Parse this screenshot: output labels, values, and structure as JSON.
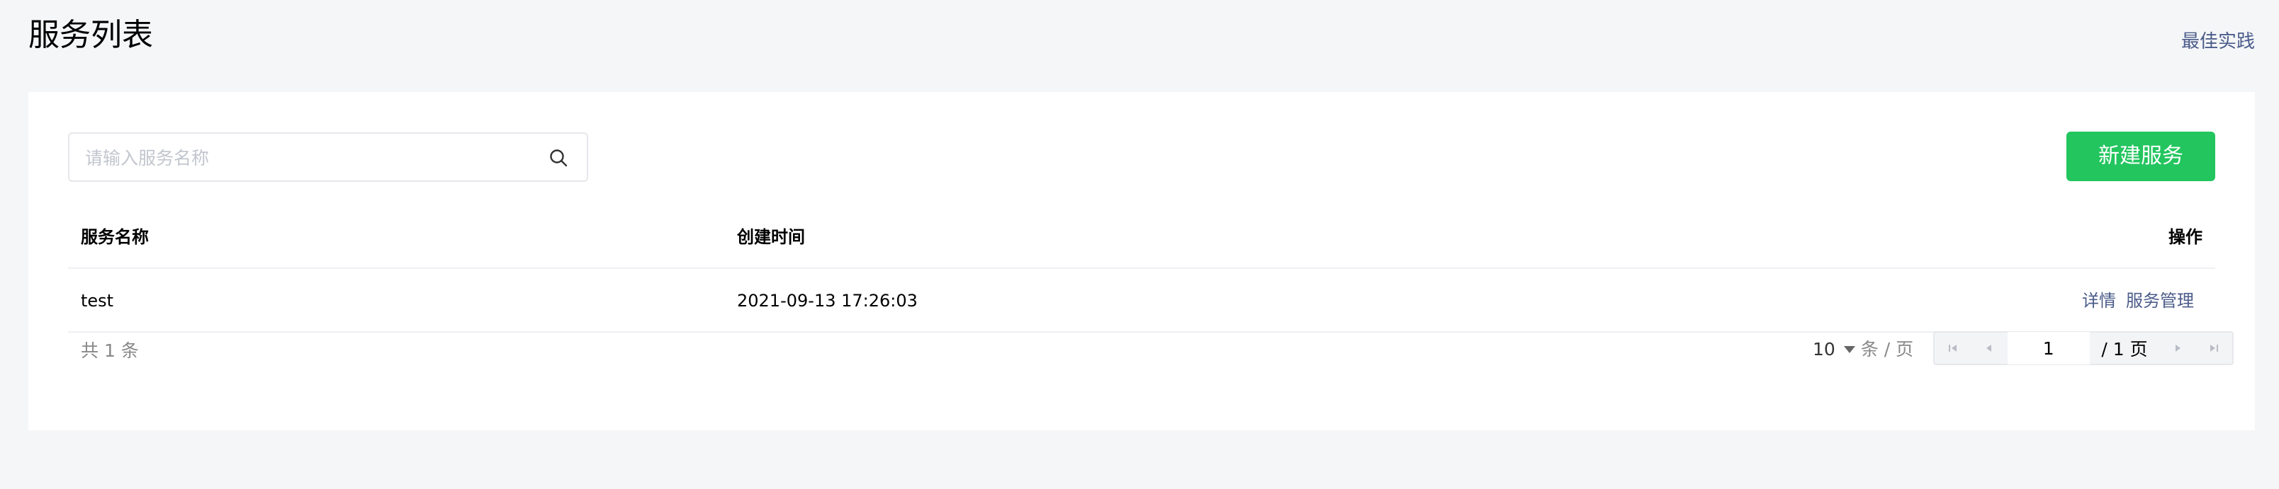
{
  "header": {
    "title": "服务列表",
    "best_practice": "最佳实践"
  },
  "search": {
    "placeholder": "请输入服务名称",
    "value": ""
  },
  "actions": {
    "new_service": "新建服务"
  },
  "table": {
    "columns": [
      "服务名称",
      "创建时间",
      "操作"
    ],
    "rows": [
      {
        "name": "test",
        "created": "2021-09-13 17:26:03",
        "ops": [
          "详情",
          "服务管理"
        ]
      }
    ]
  },
  "pagination": {
    "total_text": "共 1 条",
    "page_size": "10",
    "per_page_label": "条 / 页",
    "current_page": "1",
    "total_pages_text": "/ 1 页"
  },
  "colors": {
    "accent": "#22c55e",
    "link": "#4b5c8a",
    "background": "#f5f6f8"
  }
}
